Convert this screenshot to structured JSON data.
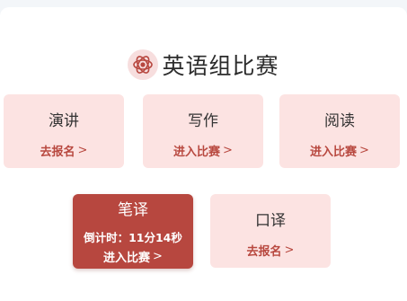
{
  "header": {
    "title": "英语组比赛",
    "icon": "flower-logo-icon"
  },
  "colors": {
    "card_bg": "#fce3e2",
    "accent": "#b7473f",
    "action_text": "#b8483f"
  },
  "cards": [
    {
      "name": "演讲",
      "action": "去报名",
      "chevron": ">"
    },
    {
      "name": "写作",
      "action": "进入比赛",
      "chevron": ">"
    },
    {
      "name": "阅读",
      "action": "进入比赛",
      "chevron": ">"
    },
    {
      "name": "笔译",
      "countdown": "倒计时：11分14秒",
      "action": "进入比赛",
      "chevron": ">",
      "active": true
    },
    {
      "name": "口译",
      "action": "去报名",
      "chevron": ">"
    }
  ]
}
